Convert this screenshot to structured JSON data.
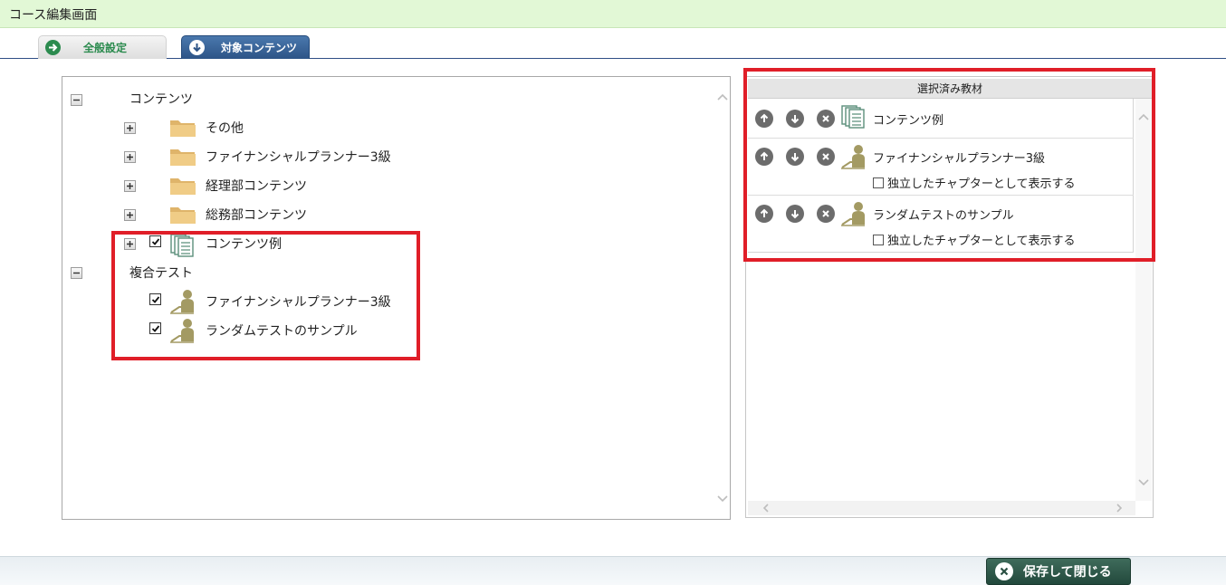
{
  "window": {
    "title": "コース編集画面"
  },
  "tabs": [
    {
      "label": "全般設定",
      "icon": "arrow-right-icon",
      "active": false
    },
    {
      "label": "対象コンテンツ",
      "icon": "arrow-down-icon",
      "active": true
    }
  ],
  "tree": {
    "groups": [
      {
        "label": "コンテンツ",
        "expanded": true,
        "children": [
          {
            "label": "その他",
            "icon": "folder-icon",
            "checked": null
          },
          {
            "label": "ファイナンシャルプランナー3級",
            "icon": "folder-icon",
            "checked": null
          },
          {
            "label": "経理部コンテンツ",
            "icon": "folder-icon",
            "checked": null
          },
          {
            "label": "総務部コンテンツ",
            "icon": "folder-icon",
            "checked": null
          },
          {
            "label": "コンテンツ例",
            "icon": "document-stack-icon",
            "checked": true
          }
        ]
      },
      {
        "label": "複合テスト",
        "expanded": true,
        "children": [
          {
            "label": "ファイナンシャルプランナー3級",
            "icon": "test-person-icon",
            "checked": true
          },
          {
            "label": "ランダムテストのサンプル",
            "icon": "test-person-icon",
            "checked": true
          }
        ]
      }
    ]
  },
  "selected": {
    "header": "選択済み教材",
    "items": [
      {
        "label": "コンテンツ例",
        "icon": "document-stack-icon"
      },
      {
        "label": "ファイナンシャルプランナー3級",
        "icon": "test-person-icon",
        "option_label": "独立したチャプターとして表示する",
        "option_checked": false
      },
      {
        "label": "ランダムテストのサンプル",
        "icon": "test-person-icon",
        "option_label": "独立したチャプターとして表示する",
        "option_checked": false
      }
    ]
  },
  "footer": {
    "save_close_label": "保存して閉じる"
  },
  "colors": {
    "highlight": "#e01e28",
    "tab_active": "#2d5487",
    "title_bg": "#e2f8d6",
    "folder": "#e9c37a",
    "test_icon": "#a39a63"
  }
}
